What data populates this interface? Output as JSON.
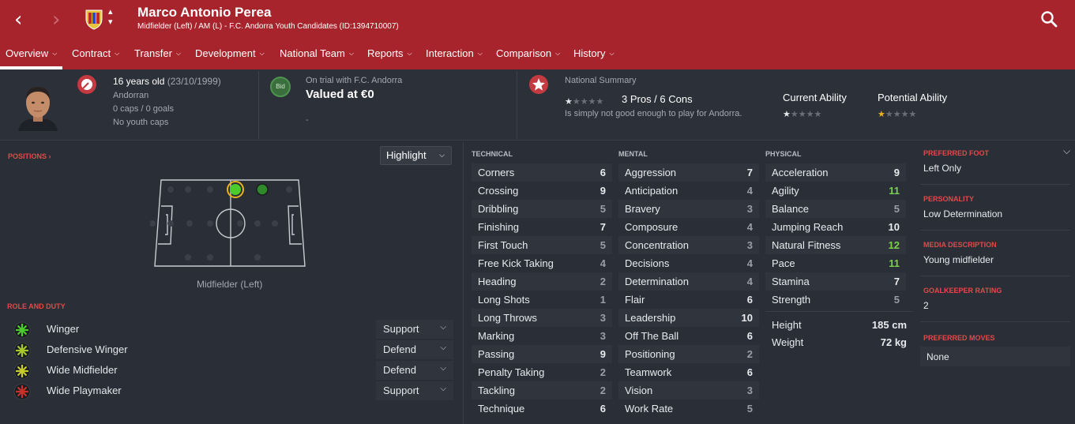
{
  "header": {
    "player_name": "Marco Antonio Perea",
    "player_subtitle": "Midfielder (Left) / AM (L) - F.C. Andorra Youth Candidates (ID:1394710007)",
    "back_icon": "chevron-left-icon",
    "forward_icon": "chevron-right-icon",
    "search_icon": "search-icon"
  },
  "tabs": [
    {
      "label": "Overview"
    },
    {
      "label": "Contract"
    },
    {
      "label": "Transfer"
    },
    {
      "label": "Development"
    },
    {
      "label": "National Team"
    },
    {
      "label": "Reports"
    },
    {
      "label": "Interaction"
    },
    {
      "label": "Comparison"
    },
    {
      "label": "History"
    }
  ],
  "summary": {
    "age": "16 years old",
    "dob": "(23/10/1999)",
    "nationality": "Andorran",
    "caps": "0 caps / 0 goals",
    "youth_caps": "No youth caps",
    "trial_text": "On trial with F.C. Andorra",
    "value": "Valued at €0",
    "bid_label": "Bid",
    "dash": "-",
    "national_summary_title": "National Summary",
    "pros_cons": "3 Pros / 6 Cons",
    "national_note": "Is simply not good enough to play for Andorra.",
    "current_ability_label": "Current Ability",
    "potential_ability_label": "Potential Ability",
    "national_stars": 0.5,
    "current_ability_stars": 0.5,
    "potential_ability_stars": 0.5
  },
  "positions": {
    "title": "POSITIONS",
    "highlight_label": "Highlight",
    "position_label": "Midfielder (Left)"
  },
  "role_and_duty": {
    "title": "ROLE AND DUTY",
    "roles": [
      {
        "name": "Winger",
        "duty": "Support",
        "color": "#4ccc2a"
      },
      {
        "name": "Defensive Winger",
        "duty": "Defend",
        "color": "#a8c82a"
      },
      {
        "name": "Wide Midfielder",
        "duty": "Defend",
        "color": "#c8cc2a"
      },
      {
        "name": "Wide Playmaker",
        "duty": "Support",
        "color": "#c8302a"
      }
    ]
  },
  "technical": {
    "title": "TECHNICAL",
    "attrs": [
      {
        "name": "Corners",
        "value": "6"
      },
      {
        "name": "Crossing",
        "value": "9"
      },
      {
        "name": "Dribbling",
        "value": "5"
      },
      {
        "name": "Finishing",
        "value": "7"
      },
      {
        "name": "First Touch",
        "value": "5"
      },
      {
        "name": "Free Kick Taking",
        "value": "4"
      },
      {
        "name": "Heading",
        "value": "2"
      },
      {
        "name": "Long Shots",
        "value": "1"
      },
      {
        "name": "Long Throws",
        "value": "3"
      },
      {
        "name": "Marking",
        "value": "3"
      },
      {
        "name": "Passing",
        "value": "9"
      },
      {
        "name": "Penalty Taking",
        "value": "2"
      },
      {
        "name": "Tackling",
        "value": "2"
      },
      {
        "name": "Technique",
        "value": "6"
      }
    ]
  },
  "mental": {
    "title": "MENTAL",
    "attrs": [
      {
        "name": "Aggression",
        "value": "7"
      },
      {
        "name": "Anticipation",
        "value": "4"
      },
      {
        "name": "Bravery",
        "value": "3"
      },
      {
        "name": "Composure",
        "value": "4"
      },
      {
        "name": "Concentration",
        "value": "3"
      },
      {
        "name": "Decisions",
        "value": "4"
      },
      {
        "name": "Determination",
        "value": "4"
      },
      {
        "name": "Flair",
        "value": "6"
      },
      {
        "name": "Leadership",
        "value": "10"
      },
      {
        "name": "Off The Ball",
        "value": "6"
      },
      {
        "name": "Positioning",
        "value": "2"
      },
      {
        "name": "Teamwork",
        "value": "6"
      },
      {
        "name": "Vision",
        "value": "3"
      },
      {
        "name": "Work Rate",
        "value": "5"
      }
    ]
  },
  "physical": {
    "title": "PHYSICAL",
    "attrs": [
      {
        "name": "Acceleration",
        "value": "9"
      },
      {
        "name": "Agility",
        "value": "11"
      },
      {
        "name": "Balance",
        "value": "5"
      },
      {
        "name": "Jumping Reach",
        "value": "10"
      },
      {
        "name": "Natural Fitness",
        "value": "12"
      },
      {
        "name": "Pace",
        "value": "11"
      },
      {
        "name": "Stamina",
        "value": "7"
      },
      {
        "name": "Strength",
        "value": "5"
      }
    ],
    "height_label": "Height",
    "height_value": "185 cm",
    "weight_label": "Weight",
    "weight_value": "72 kg"
  },
  "details": {
    "preferred_foot_title": "PREFERRED FOOT",
    "preferred_foot": "Left Only",
    "personality_title": "PERSONALITY",
    "personality": "Low Determination",
    "media_title": "MEDIA DESCRIPTION",
    "media": "Young midfielder",
    "gk_title": "GOALKEEPER RATING",
    "gk": "2",
    "moves_title": "PREFERRED MOVES",
    "moves": "None"
  },
  "colors": {
    "header": "#a8242c",
    "background": "#2a2e36",
    "accent_red": "#e04a4a",
    "high_value": "#7cd04a"
  }
}
